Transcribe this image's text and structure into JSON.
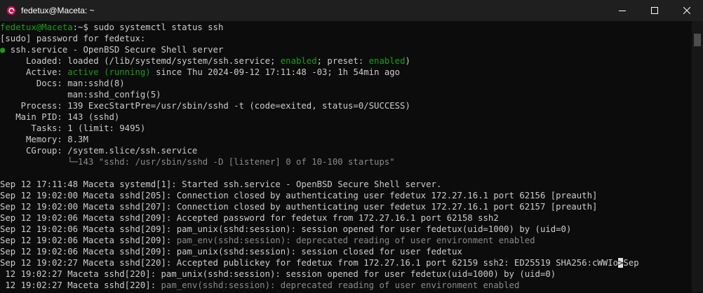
{
  "window": {
    "title": "fedetux@Maceta: ~",
    "accent": "#d70a53"
  },
  "prompt": {
    "user_host": "fedetux@Maceta",
    "path": ":~",
    "symbol": "$",
    "command": " sudo systemctl status ssh"
  },
  "sudo_line": "[sudo] password for fedetux:",
  "service": {
    "bullet": "●",
    "header": " ssh.service - OpenBSD Secure Shell server",
    "loaded_pre": "     Loaded: loaded (/lib/systemd/system/ssh.service; ",
    "loaded_enabled": "enabled",
    "loaded_mid": "; preset: ",
    "loaded_preset": "enabled",
    "loaded_post": ")",
    "active_pre": "     Active: ",
    "active_state": "active (running)",
    "active_post": " since Thu 2024-09-12 17:11:48 -03; 1h 54min ago",
    "docs1": "       Docs: man:sshd(8)",
    "docs2": "             man:sshd_config(5)",
    "process": "    Process: 139 ExecStartPre=/usr/sbin/sshd -t (code=exited, status=0/SUCCESS)",
    "main_pid": "   Main PID: 143 (sshd)",
    "tasks": "      Tasks: 1 (limit: 9495)",
    "memory": "     Memory: 8.3M",
    "cgroup": "     CGroup: /system.slice/ssh.service",
    "cgroup_child_pre": "             ",
    "cgroup_child_text": "└─143 \"sshd: /usr/sbin/sshd -D [listener] 0 of 10-100 startups\""
  },
  "logs": {
    "l1": "Sep 12 17:11:48 Maceta systemd[1]: Started ssh.service - OpenBSD Secure Shell server.",
    "l2": "Sep 12 19:02:00 Maceta sshd[205]: Connection closed by authenticating user fedetux 172.27.16.1 port 62156 [preauth]",
    "l3": "Sep 12 19:02:00 Maceta sshd[207]: Connection closed by authenticating user fedetux 172.27.16.1 port 62157 [preauth]",
    "l4": "Sep 12 19:02:06 Maceta sshd[209]: Accepted password for fedetux from 172.27.16.1 port 62158 ssh2",
    "l5": "Sep 12 19:02:06 Maceta sshd[209]: pam_unix(sshd:session): session opened for user fedetux(uid=1000) by (uid=0)",
    "l6_pre": "Sep 12 19:02:06 Maceta sshd[209]: ",
    "l6_dim": "pam_env(sshd:session): deprecated reading of user environment enabled",
    "l7": "Sep 12 19:02:06 Maceta sshd[209]: pam_unix(sshd:session): session closed for user fedetux",
    "l8_pre": "Sep 12 19:02:27 Maceta sshd[220]: Accepted publickey for fedetux from 172.27.16.1 port 62159 ssh2: ED25519 SHA256:cWWIo",
    "l8_cursor": ">",
    "l8_post": "Sep",
    "l9": " 12 19:02:27 Maceta sshd[220]: pam_unix(sshd:session): session opened for user fedetux(uid=1000) by (uid=0)",
    "l10_pre": " 12 19:02:27 Maceta sshd[220]: ",
    "l10_dim": "pam_env(sshd:session): deprecated reading of user environment enabled"
  }
}
